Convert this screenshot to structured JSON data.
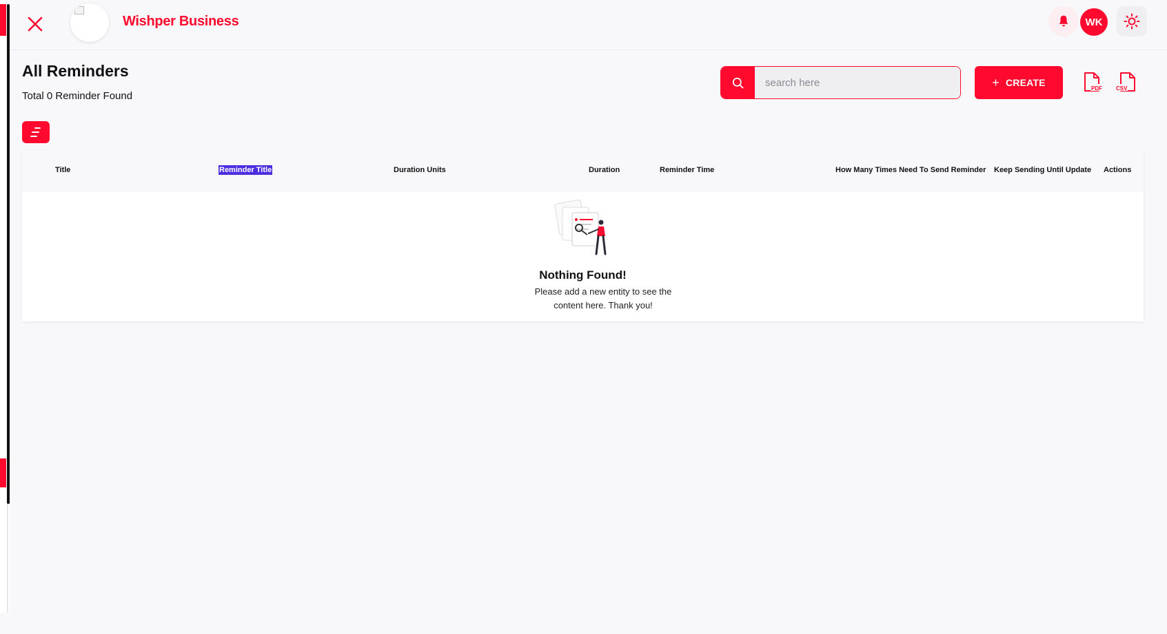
{
  "header": {
    "brand": "Wishper Business",
    "avatar_initials": "WK",
    "icons": [
      "close-icon",
      "bell-icon",
      "sun-icon"
    ]
  },
  "page": {
    "title": "All Reminders",
    "count_text": "Total 0 Reminder Found"
  },
  "toolbar": {
    "search_placeholder": "search here",
    "search_value": "",
    "create_label": "CREATE",
    "pdf_label": "PDF",
    "csv_label": "CSV"
  },
  "table": {
    "columns": [
      "Title",
      "Reminder Title",
      "Duration Units",
      "Duration",
      "Reminder Time",
      "How Many Times Need To Send Reminder",
      "Keep Sending Until Update",
      "Actions"
    ],
    "rows": [],
    "empty_title": "Nothing Found!",
    "empty_text": "Please add a new entity to see the content here. Thank you!"
  },
  "colors": {
    "accent": "#ff0a2e",
    "selection": "#4c2ee0",
    "background": "#f8f8fa"
  }
}
